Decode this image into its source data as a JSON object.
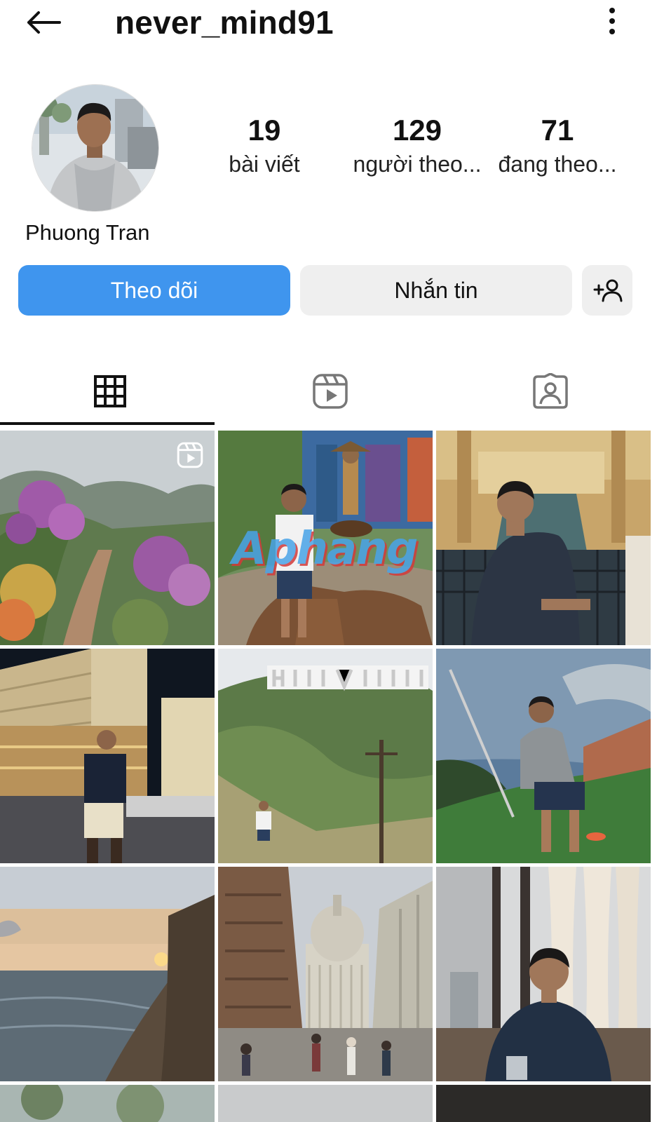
{
  "header": {
    "username": "never_mind91",
    "back_icon": "arrow-left-icon",
    "more_icon": "more-vertical-icon"
  },
  "profile": {
    "display_name": "Phuong Tran",
    "stats": {
      "posts": {
        "value": "19",
        "label": "bài viết"
      },
      "followers": {
        "value": "129",
        "label": "người theo..."
      },
      "following": {
        "value": "71",
        "label": "đang theo..."
      }
    }
  },
  "actions": {
    "follow_label": "Theo dõi",
    "message_label": "Nhắn tin",
    "add_user_icon": "add-user-icon"
  },
  "tabs": [
    {
      "name": "grid",
      "icon": "grid-icon",
      "selected": true
    },
    {
      "name": "reels",
      "icon": "reels-icon",
      "selected": false
    },
    {
      "name": "tagged",
      "icon": "tagged-icon",
      "selected": false
    }
  ],
  "grid": {
    "watermark": "Aphang",
    "posts": [
      {
        "scene": "flower-garden",
        "is_reel": true
      },
      {
        "scene": "statue-park",
        "is_reel": false
      },
      {
        "scene": "canal-mall",
        "is_reel": false
      },
      {
        "scene": "night-hotel",
        "is_reel": false
      },
      {
        "scene": "hollywood-hills",
        "is_reel": false
      },
      {
        "scene": "soccer-field",
        "is_reel": false
      },
      {
        "scene": "sunset-beach",
        "is_reel": false
      },
      {
        "scene": "london-street",
        "is_reel": false
      },
      {
        "scene": "restaurant-window",
        "is_reel": false
      }
    ]
  },
  "colors": {
    "accent": "#3f95ee",
    "button_secondary": "#efefef",
    "text": "#111111"
  }
}
